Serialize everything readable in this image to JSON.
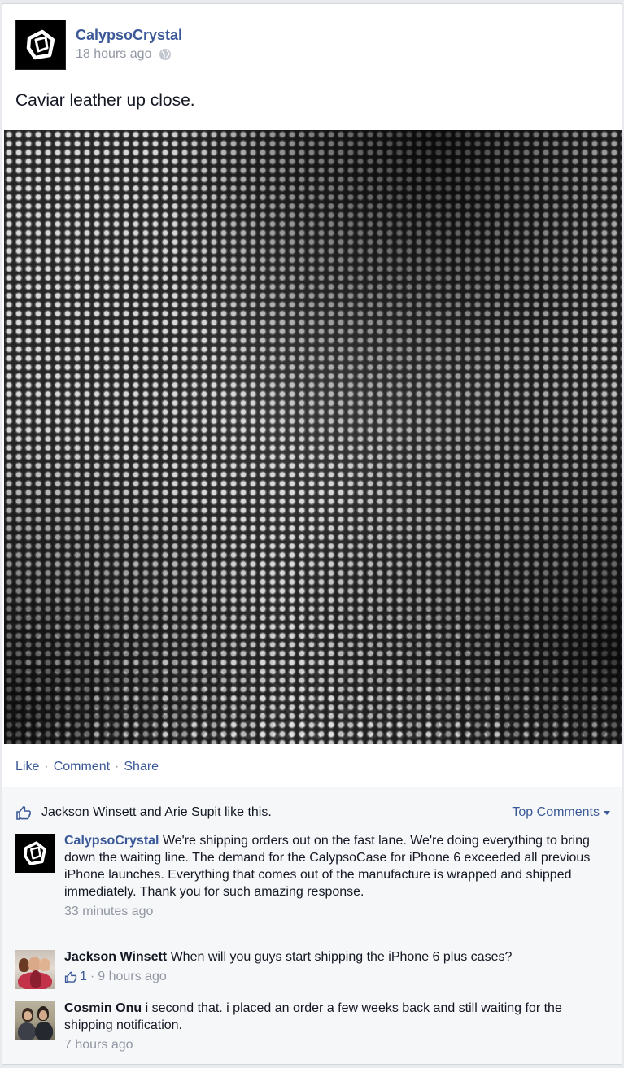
{
  "post": {
    "page_name": "CalypsoCrystal",
    "timestamp": "18 hours ago",
    "privacy_icon": "globe-icon",
    "text": "Caviar leather up close."
  },
  "actions": {
    "like": "Like",
    "sep1": "·",
    "comment": "Comment",
    "sep2": "·",
    "share": "Share"
  },
  "likes": {
    "text": "Jackson Winsett and Arie Supit like this.",
    "top_comments": "Top Comments"
  },
  "comments": [
    {
      "author": "CalypsoCrystal",
      "text": "We're shipping orders out on the fast lane. We're doing everything to bring down the waiting line. The demand for the CalypsoCase for iPhone 6 exceeded all previous iPhone launches. Everything that comes out of the manufacture is wrapped and shipped immediately. Thank you for such amazing response.",
      "time": "33 minutes ago"
    },
    {
      "author": "Jackson Winsett",
      "text": "When will you guys start shipping the iPhone 6 plus cases?",
      "likes": "1",
      "dot": "·",
      "time": "9 hours ago"
    },
    {
      "author": "Cosmin Onu",
      "text": "i second that. i placed an order a few weeks back and still waiting for the shipping notification.",
      "time": "7 hours ago"
    }
  ],
  "colors": {
    "link": "#3b5998",
    "meta": "#9197a3",
    "background": "#e9eaed"
  }
}
